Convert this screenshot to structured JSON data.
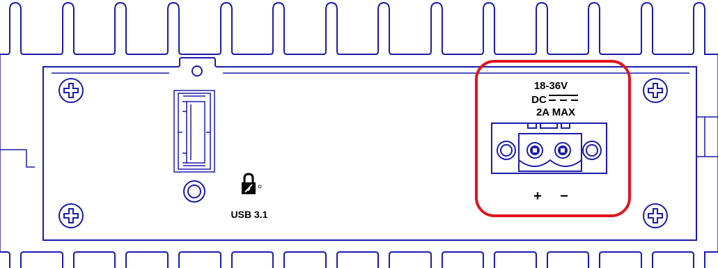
{
  "power_label": {
    "voltage": "18-36V",
    "dc": "DC",
    "max": "2A MAX"
  },
  "polarity": {
    "plus": "+",
    "minus": "−"
  },
  "usb_label": "USB 3.1",
  "colors": {
    "outline": "#1a1aaa",
    "highlight": "#e0141e"
  },
  "icons": [
    "screw-icon",
    "usb-lock-icon",
    "dc-symbol-icon",
    "terminal-block-icon"
  ]
}
